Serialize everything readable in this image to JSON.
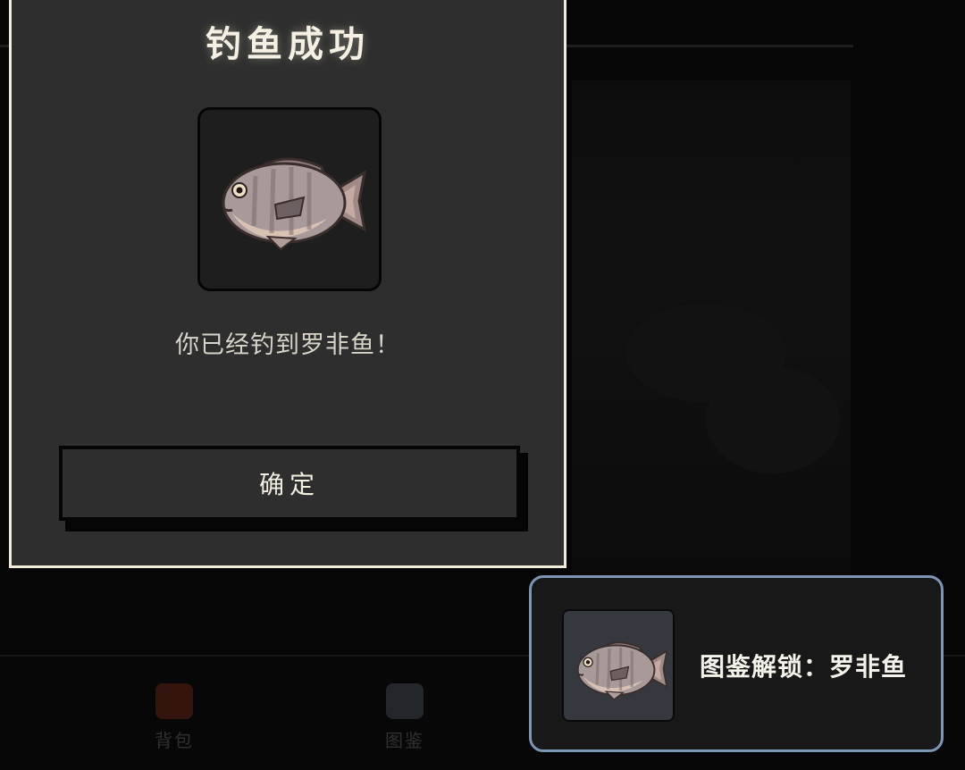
{
  "modal": {
    "title": "钓鱼成功",
    "message": "你已经钓到罗非鱼！",
    "confirm_label": "确定",
    "fish_icon": "tilapia-fish-icon"
  },
  "toast": {
    "text": "图鉴解锁：罗非鱼",
    "fish_icon": "tilapia-fish-icon"
  },
  "bottom_nav": {
    "items": [
      {
        "label": "背包",
        "icon": "backpack-icon"
      },
      {
        "label": "图鉴",
        "icon": "book-icon"
      },
      {
        "label": "",
        "icon": "unknown-icon"
      },
      {
        "label": "",
        "icon": "unknown-icon"
      }
    ]
  },
  "colors": {
    "modal_border": "#f2ecd8",
    "modal_bg": "#2e2e2e",
    "toast_border": "#7c96b6",
    "backpack_icon": "#a83a22"
  }
}
